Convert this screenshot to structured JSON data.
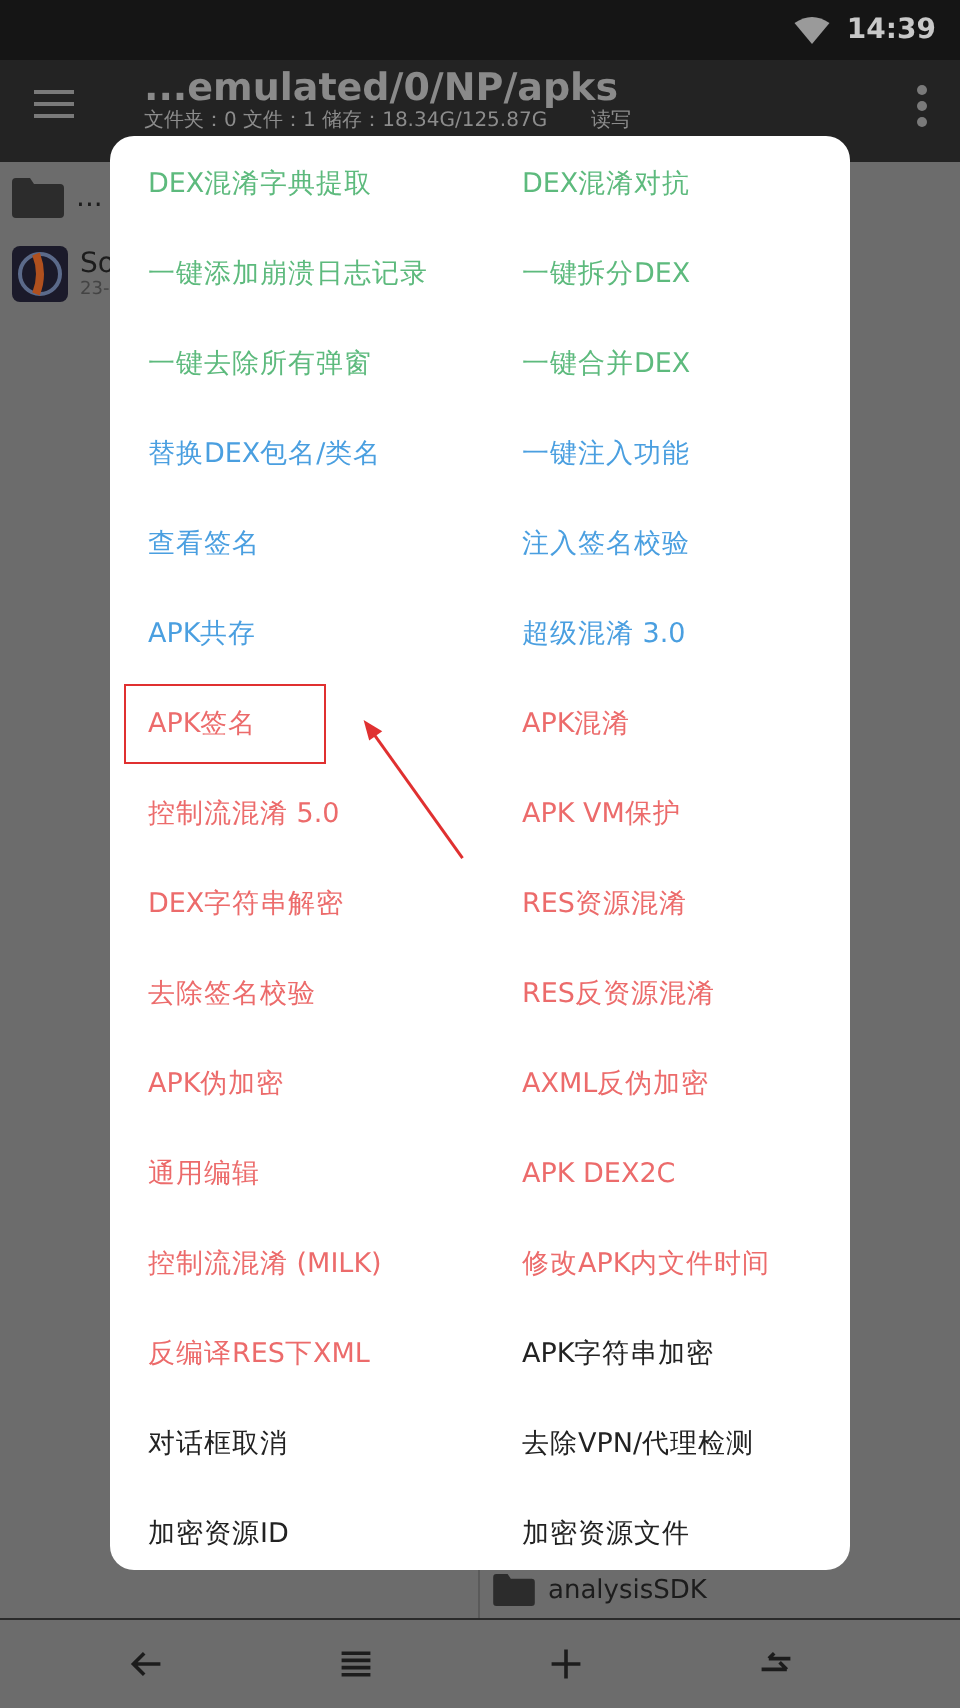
{
  "status_bar": {
    "time": "14:39"
  },
  "toolbar": {
    "title": "...emulated/0/NP/apks",
    "subtitle": "文件夹：0  文件：1  储存：18.34G/125.87G",
    "subtitle_right": "读写"
  },
  "left_pane": [
    {
      "kind": "folder",
      "name": "..."
    },
    {
      "kind": "app",
      "name": "So",
      "detail": "23-"
    }
  ],
  "right_pane": [
    {
      "kind": "folder",
      "name": "analysisSDK"
    }
  ],
  "menu": [
    {
      "label": "DEX混淆字典提取",
      "color": "#5dba7d",
      "highlighted": false
    },
    {
      "label": "DEX混淆对抗",
      "color": "#5dba7d",
      "highlighted": false
    },
    {
      "label": "一键添加崩溃日志记录",
      "color": "#5dba7d",
      "highlighted": false
    },
    {
      "label": "一键拆分DEX",
      "color": "#5dba7d",
      "highlighted": false
    },
    {
      "label": "一键去除所有弹窗",
      "color": "#5dba7d",
      "highlighted": false
    },
    {
      "label": "一键合并DEX",
      "color": "#5dba7d",
      "highlighted": false
    },
    {
      "label": "替换DEX包名/类名",
      "color": "#4a9fe0",
      "highlighted": false
    },
    {
      "label": "一键注入功能",
      "color": "#4a9fe0",
      "highlighted": false
    },
    {
      "label": "查看签名",
      "color": "#4a9fe0",
      "highlighted": false
    },
    {
      "label": "注入签名校验",
      "color": "#4a9fe0",
      "highlighted": false
    },
    {
      "label": "APK共存",
      "color": "#4a9fe0",
      "highlighted": false
    },
    {
      "label": "超级混淆 3.0",
      "color": "#4a9fe0",
      "highlighted": false
    },
    {
      "label": "APK签名",
      "color": "#ec6b6b",
      "highlighted": true
    },
    {
      "label": "APK混淆",
      "color": "#ec6b6b",
      "highlighted": false
    },
    {
      "label": "控制流混淆 5.0",
      "color": "#ec6b6b",
      "highlighted": false
    },
    {
      "label": "APK VM保护",
      "color": "#ec6b6b",
      "highlighted": false
    },
    {
      "label": "DEX字符串解密",
      "color": "#ec6b6b",
      "highlighted": false
    },
    {
      "label": "RES资源混淆",
      "color": "#ec6b6b",
      "highlighted": false
    },
    {
      "label": "去除签名校验",
      "color": "#ec6b6b",
      "highlighted": false
    },
    {
      "label": "RES反资源混淆",
      "color": "#ec6b6b",
      "highlighted": false
    },
    {
      "label": "APK伪加密",
      "color": "#ec6b6b",
      "highlighted": false
    },
    {
      "label": "AXML反伪加密",
      "color": "#ec6b6b",
      "highlighted": false
    },
    {
      "label": "通用编辑",
      "color": "#ec6b6b",
      "highlighted": false
    },
    {
      "label": "APK DEX2C",
      "color": "#ec6b6b",
      "highlighted": false
    },
    {
      "label": "控制流混淆 (MILK)",
      "color": "#ec6b6b",
      "highlighted": false
    },
    {
      "label": "修改APK内文件时间",
      "color": "#ec6b6b",
      "highlighted": false
    },
    {
      "label": "反编译RES下XML",
      "color": "#ec6b6b",
      "highlighted": false
    },
    {
      "label": "APK字符串加密",
      "color": "#222222",
      "highlighted": false
    },
    {
      "label": "对话框取消",
      "color": "#222222",
      "highlighted": false
    },
    {
      "label": "去除VPN/代理检测",
      "color": "#222222",
      "highlighted": false
    },
    {
      "label": "加密资源ID",
      "color": "#222222",
      "highlighted": false
    },
    {
      "label": "加密资源文件",
      "color": "#222222",
      "highlighted": false
    }
  ]
}
